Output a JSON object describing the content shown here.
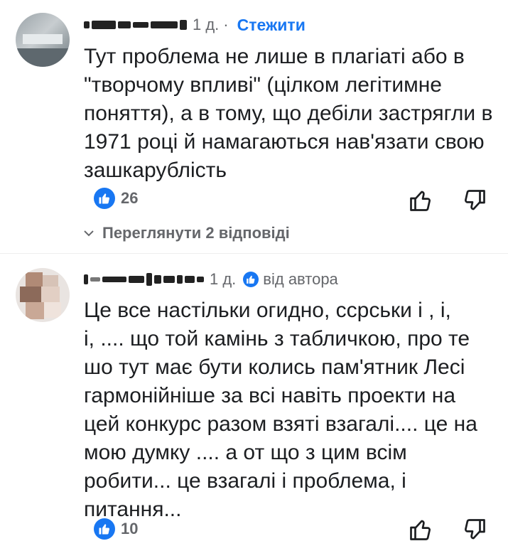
{
  "comments": [
    {
      "time": "1 д.",
      "separator": "·",
      "follow_label": "Стежити",
      "text": "Тут проблема не лише в плагіаті або в\n\"творчому впливі\" (цілком легітимне\nпоняття), а в тому, що дебіли застрягли в\n1971 році й намагаються нав'язати свою\nзашкарублість",
      "like_count": "26",
      "view_replies_label": "Переглянути 2 відповіді"
    },
    {
      "time": "1 д.",
      "author_badge_label": "від автора",
      "text": "Це все настільки огидно, ссрськи і , і,\nі, .... що той камінь з табличкою, про те\nшо тут має бути колись пам'ятник Лесі\nгармонійніше за всі навіть проекти на\nцей конкурс разом взяті взагалі.... це на\nмою думку  .... а от що з цим всім\nробити... це взагалі і проблема, і\nпитання...",
      "like_count": "10"
    }
  ],
  "icons": {
    "like_reaction": "thumbs-up-icon",
    "like_action": "thumb-up-outline-icon",
    "dislike_action": "thumb-down-outline-icon",
    "expand": "chevron-down-icon",
    "author_badge": "verified-icon"
  },
  "colors": {
    "accent": "#1877f2",
    "secondary_text": "#65676b",
    "primary_text": "#1c1e21"
  }
}
